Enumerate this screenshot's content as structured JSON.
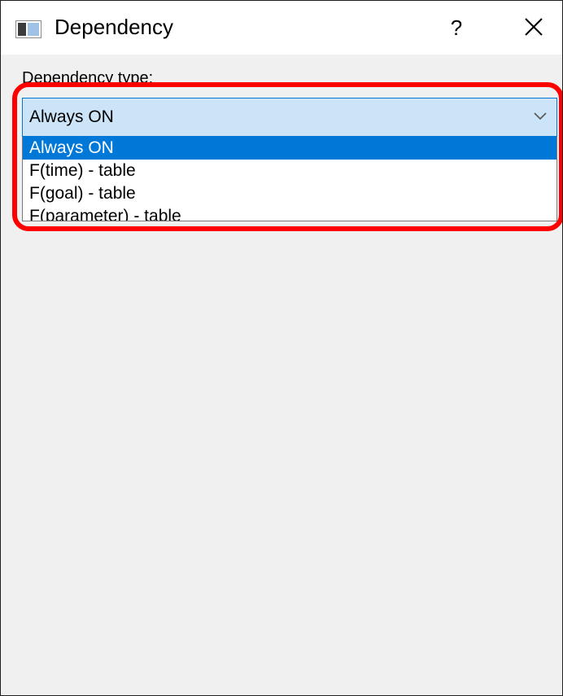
{
  "window": {
    "title": "Dependency",
    "help_label": "?",
    "close_icon": "close-icon",
    "app_icon": "window-icon"
  },
  "form": {
    "dependency_type_label": "Dependency type:",
    "dependency_type_value": "Always ON",
    "dropdown_icon": "chevron-down-icon",
    "options": [
      {
        "label": "Always ON",
        "selected": true
      },
      {
        "label": "F(time) - table",
        "selected": false
      },
      {
        "label": "F(goal) - table",
        "selected": false
      },
      {
        "label": "F(parameter) - table",
        "selected": false
      }
    ]
  },
  "colors": {
    "selection": "#0078d7",
    "combo_background": "#cce4f7",
    "annotation": "#ff0000",
    "dialog_background": "#f0f0f0"
  }
}
